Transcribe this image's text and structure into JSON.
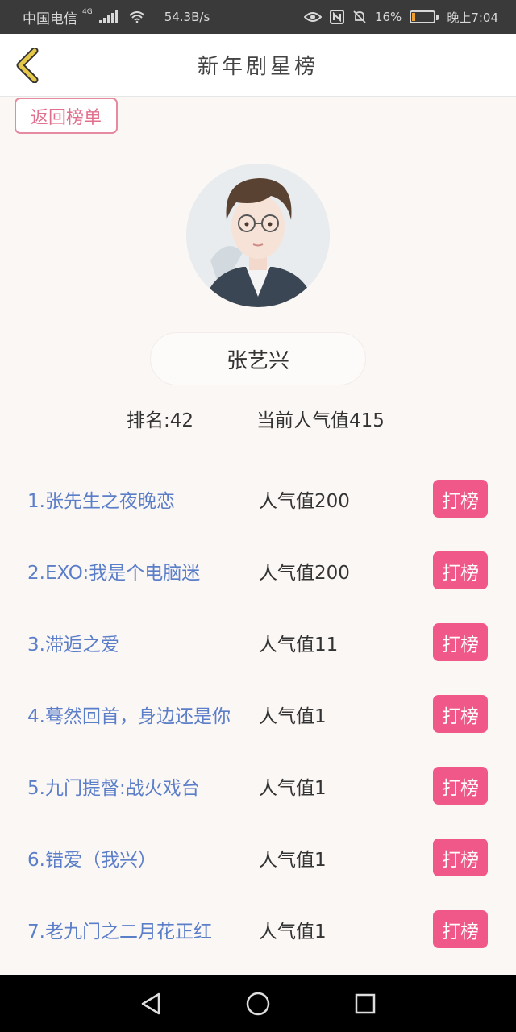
{
  "status_bar": {
    "carrier": "中国电信",
    "network_badge": "4G",
    "speed": "54.3B/s",
    "battery_pct": "16%",
    "time": "晚上7:04",
    "battery_color": "#f0a030"
  },
  "header": {
    "title": "新年剧星榜"
  },
  "return_button": "返回榜单",
  "star": {
    "name": "张艺兴",
    "rank_text": "排名:42",
    "popularity_text": "当前人气值415"
  },
  "dramas": [
    {
      "title": "1.张先生之夜晚恋",
      "value": "人气值200",
      "button": "打榜"
    },
    {
      "title": "2.EXO:我是个电脑迷",
      "value": "人气值200",
      "button": "打榜"
    },
    {
      "title": "3.滞逅之爱",
      "value": "人气值11",
      "button": "打榜"
    },
    {
      "title": "4.蓦然回首，身边还是你",
      "value": "人气值1",
      "button": "打榜"
    },
    {
      "title": "5.九门提督:战火戏台",
      "value": "人气值1",
      "button": "打榜"
    },
    {
      "title": "6.错爱（我兴）",
      "value": "人气值1",
      "button": "打榜"
    },
    {
      "title": "7.老九门之二月花正红",
      "value": "人气值1",
      "button": "打榜"
    }
  ],
  "colors": {
    "accent_pink": "#f0588a",
    "link_blue": "#5b7ec9",
    "back_icon": "#e5c84a"
  }
}
